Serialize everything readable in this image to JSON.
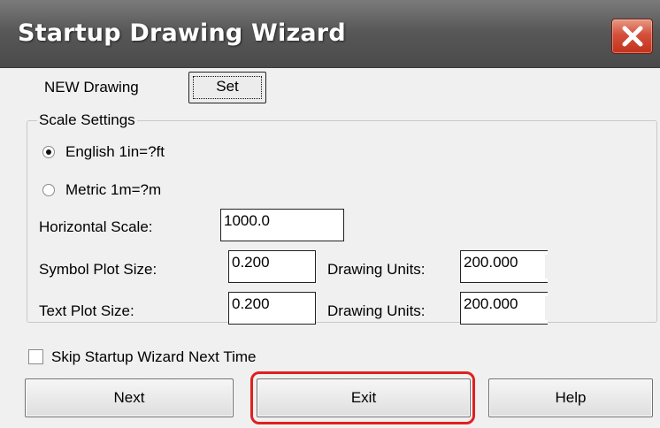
{
  "window": {
    "title": "Startup Drawing Wizard"
  },
  "new_drawing": {
    "label": "NEW Drawing",
    "set_button": "Set"
  },
  "scale_settings": {
    "group_title": "Scale Settings",
    "english_label": "English 1in=?ft",
    "metric_label": "Metric 1m=?m",
    "selected": "English 1in=?ft"
  },
  "horizontal_scale": {
    "label": "Horizontal Scale:",
    "value": "1000.0"
  },
  "symbol_plot": {
    "label": "Symbol Plot Size:",
    "value": "0.200",
    "units_label": "Drawing Units:",
    "units_value": "200.000"
  },
  "text_plot": {
    "label": "Text Plot Size:",
    "value": "0.200",
    "units_label": "Drawing Units:",
    "units_value": "200.000"
  },
  "skip_wizard": {
    "label": "Skip Startup Wizard Next Time",
    "checked": false
  },
  "buttons": {
    "next": "Next",
    "exit": "Exit",
    "help": "Help"
  },
  "colors": {
    "titlebar": "#585858",
    "close": "#c2321c",
    "highlight": "#e02020",
    "dialog_bg": "#f0f0f0"
  }
}
